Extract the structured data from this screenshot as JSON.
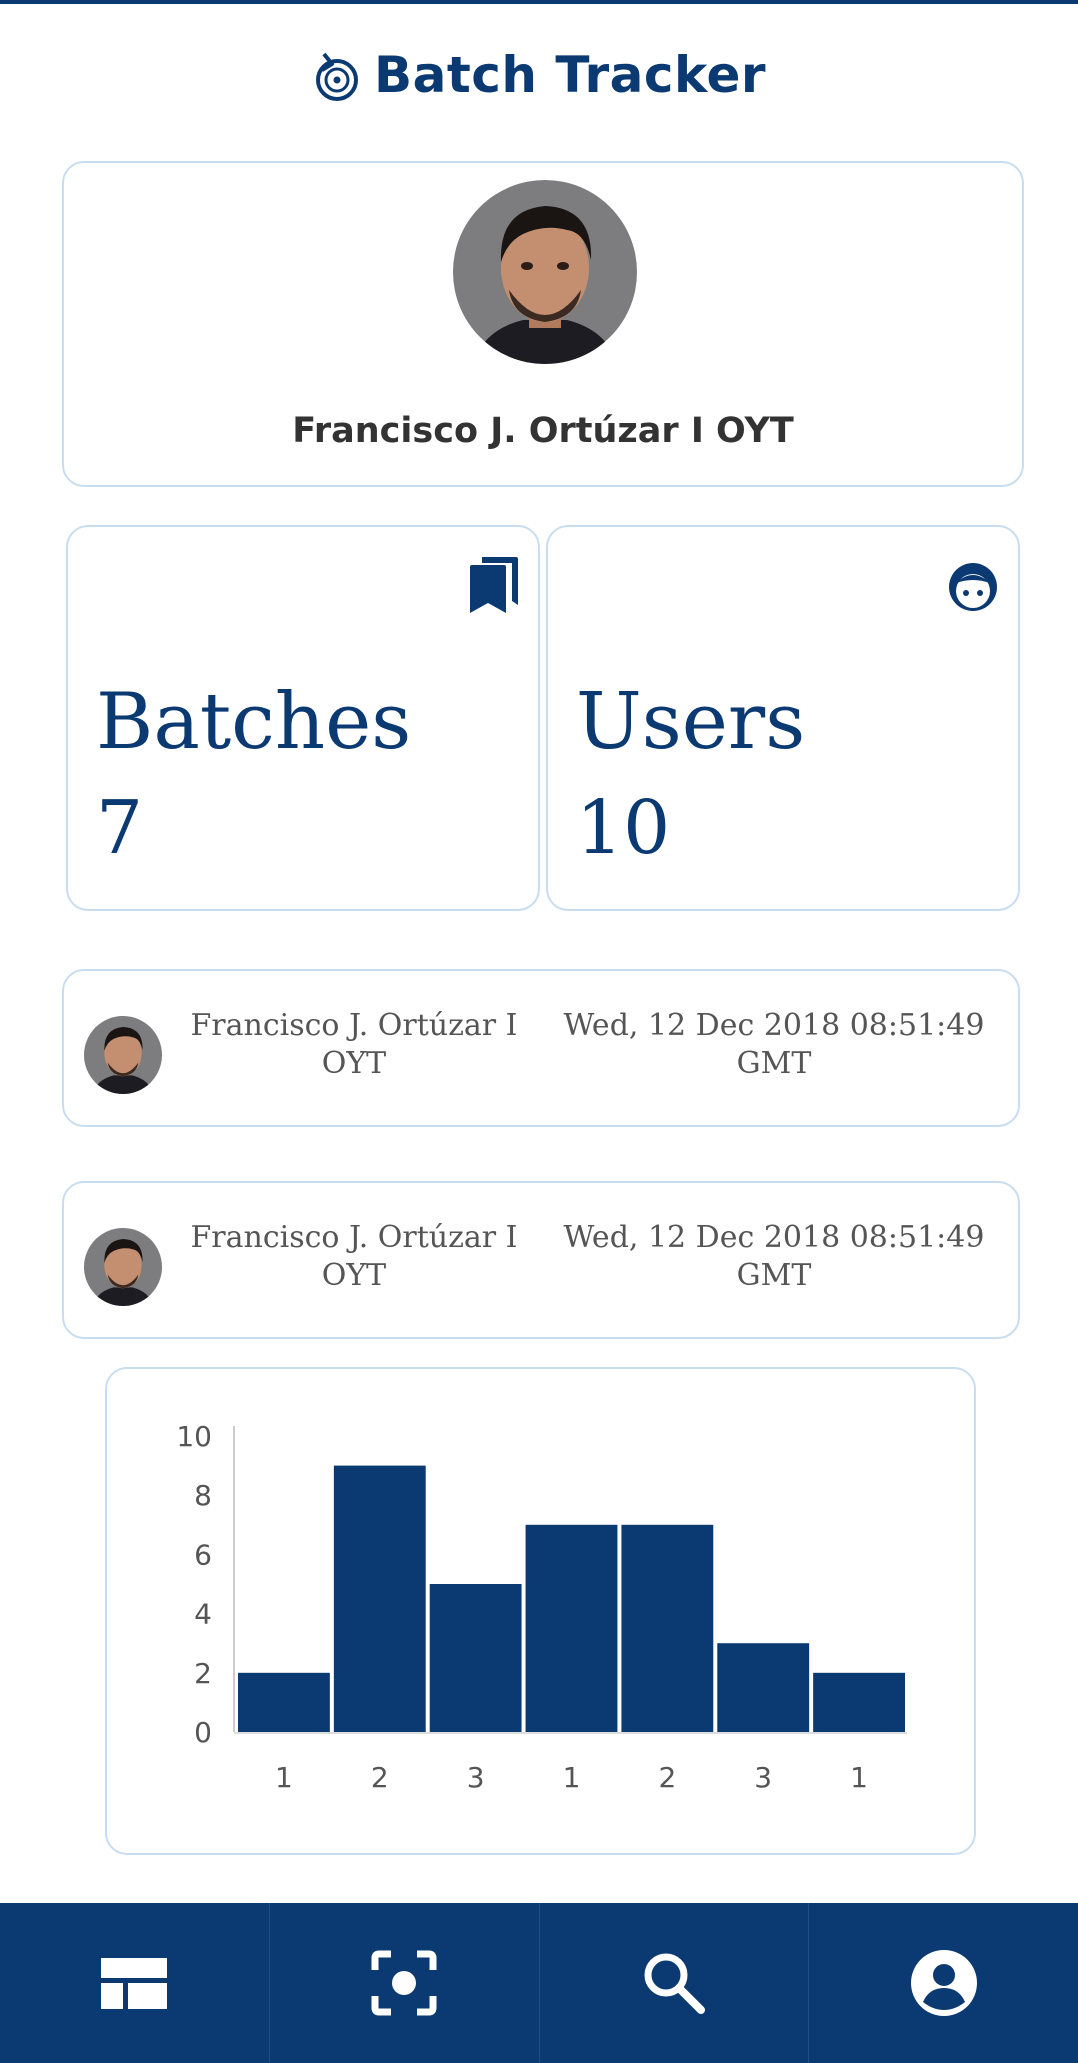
{
  "app": {
    "title": "Batch Tracker"
  },
  "profile": {
    "name": "Francisco J. Ortúzar I OYT"
  },
  "stats": {
    "batches": {
      "label": "Batches",
      "value": "7",
      "icon": "bookmarks-icon"
    },
    "users": {
      "label": "Users",
      "value": "10",
      "icon": "face-icon"
    }
  },
  "activity": [
    {
      "name": "Francisco J. Ortúzar I OYT",
      "date": "Wed, 12 Dec 2018 08:51:49 GMT"
    },
    {
      "name": "Francisco J. Ortúzar I OYT",
      "date": "Wed, 12 Dec 2018 08:51:49 GMT"
    }
  ],
  "chart_data": {
    "type": "bar",
    "categories": [
      "1",
      "2",
      "3",
      "1",
      "2",
      "3",
      "1"
    ],
    "values": [
      2,
      9,
      5,
      7,
      7,
      3,
      2
    ],
    "ylim": [
      0,
      10
    ],
    "yticks": [
      "0",
      "2",
      "4",
      "6",
      "8",
      "10"
    ],
    "bar_color": "#0b3a73",
    "grid": false,
    "title": "",
    "xlabel": "",
    "ylabel": ""
  },
  "nav": [
    {
      "icon": "dashboard-icon"
    },
    {
      "icon": "scan-icon"
    },
    {
      "icon": "search-icon"
    },
    {
      "icon": "account-icon"
    }
  ],
  "colors": {
    "primary": "#0b3a73",
    "card_border": "#c8ddf1"
  }
}
